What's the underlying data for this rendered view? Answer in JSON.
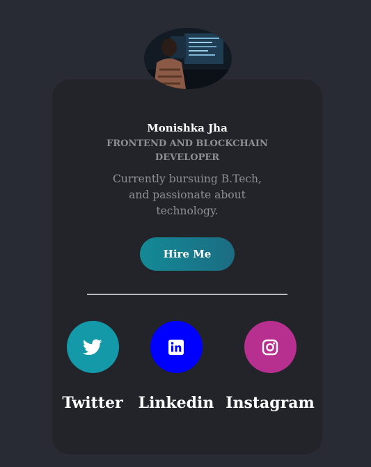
{
  "profile": {
    "name": "Monishka Jha",
    "role": "FRONTEND AND BLOCKCHAIN DEVELOPER",
    "bio": "Currently bursuing B.Tech, and passionate about technology.",
    "hire_label": "Hire Me"
  },
  "social": [
    {
      "label": "Twitter",
      "icon": "twitter-icon",
      "color": "#1499a8"
    },
    {
      "label": "Linkedin",
      "icon": "linkedin-icon",
      "color": "#0000ff"
    },
    {
      "label": "Instagram",
      "icon": "instagram-icon",
      "color": "#b8308f"
    }
  ]
}
